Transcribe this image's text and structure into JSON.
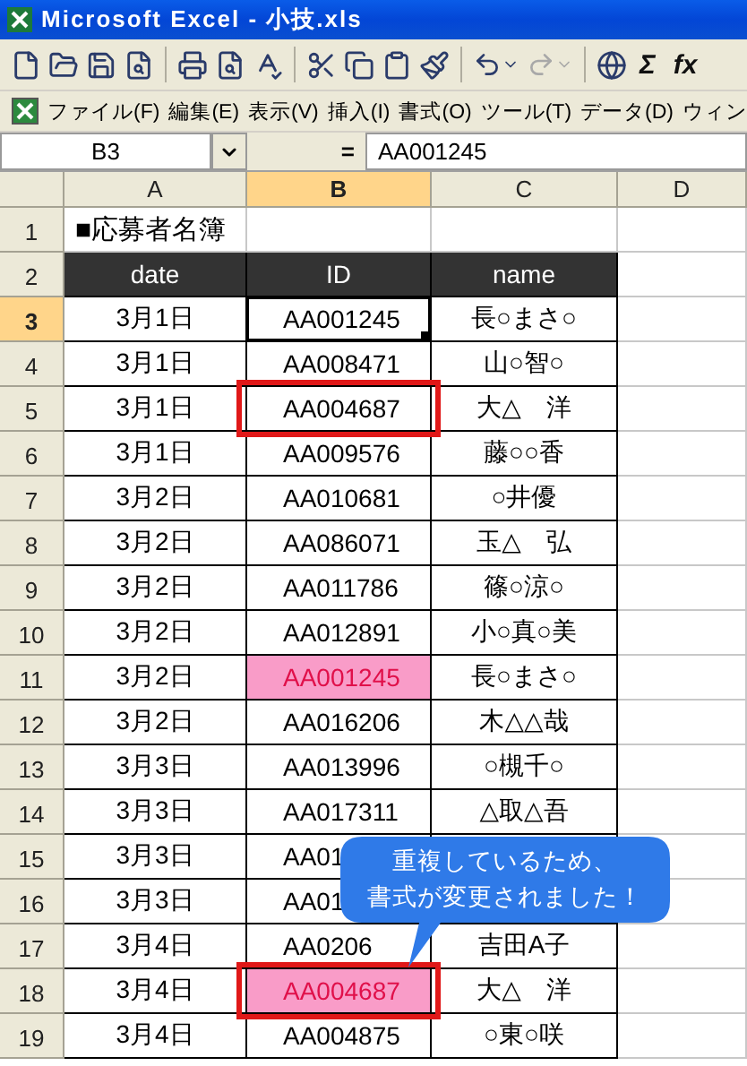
{
  "window": {
    "title": "Microsoft Excel - 小技.xls"
  },
  "toolbar": {
    "glyphs": [
      "Σ",
      "fx"
    ]
  },
  "menu": [
    "ファイル(F)",
    "編集(E)",
    "表示(V)",
    "挿入(I)",
    "書式(O)",
    "ツール(T)",
    "データ(D)",
    "ウィン"
  ],
  "formula_bar": {
    "name_box": "B3",
    "equals": "=",
    "value": "AA001245"
  },
  "columns": [
    {
      "label": "A",
      "selected": false
    },
    {
      "label": "B",
      "selected": true
    },
    {
      "label": "C",
      "selected": false
    },
    {
      "label": "D",
      "selected": false
    }
  ],
  "rows": [
    {
      "number": "1",
      "selected": false,
      "kind": "title",
      "text": "■応募者名簿"
    },
    {
      "number": "2",
      "selected": false,
      "kind": "header",
      "cells": [
        "date",
        "ID",
        "name"
      ]
    },
    {
      "number": "3",
      "selected": true,
      "kind": "data",
      "date": "3月1日",
      "id": "AA001245",
      "name": "長○まさ○",
      "active": true,
      "duplicate": false,
      "framed": false
    },
    {
      "number": "4",
      "selected": false,
      "kind": "data",
      "date": "3月1日",
      "id": "AA008471",
      "name": "山○智○",
      "active": false,
      "duplicate": false,
      "framed": false
    },
    {
      "number": "5",
      "selected": false,
      "kind": "data",
      "date": "3月1日",
      "id": "AA004687",
      "name": "大△　洋",
      "active": false,
      "duplicate": false,
      "framed": true
    },
    {
      "number": "6",
      "selected": false,
      "kind": "data",
      "date": "3月1日",
      "id": "AA009576",
      "name": "藤○○香",
      "active": false,
      "duplicate": false,
      "framed": false
    },
    {
      "number": "7",
      "selected": false,
      "kind": "data",
      "date": "3月2日",
      "id": "AA010681",
      "name": "○井優",
      "active": false,
      "duplicate": false,
      "framed": false
    },
    {
      "number": "8",
      "selected": false,
      "kind": "data",
      "date": "3月2日",
      "id": "AA086071",
      "name": "玉△　弘",
      "active": false,
      "duplicate": false,
      "framed": false
    },
    {
      "number": "9",
      "selected": false,
      "kind": "data",
      "date": "3月2日",
      "id": "AA011786",
      "name": "篠○涼○",
      "active": false,
      "duplicate": false,
      "framed": false
    },
    {
      "number": "10",
      "selected": false,
      "kind": "data",
      "date": "3月2日",
      "id": "AA012891",
      "name": "小○真○美",
      "active": false,
      "duplicate": false,
      "framed": false
    },
    {
      "number": "11",
      "selected": false,
      "kind": "data",
      "date": "3月2日",
      "id": "AA001245",
      "name": "長○まさ○",
      "active": false,
      "duplicate": true,
      "framed": false
    },
    {
      "number": "12",
      "selected": false,
      "kind": "data",
      "date": "3月2日",
      "id": "AA016206",
      "name": "木△△哉",
      "active": false,
      "duplicate": false,
      "framed": false
    },
    {
      "number": "13",
      "selected": false,
      "kind": "data",
      "date": "3月3日",
      "id": "AA013996",
      "name": "○槻千○",
      "active": false,
      "duplicate": false,
      "framed": false
    },
    {
      "number": "14",
      "selected": false,
      "kind": "data",
      "date": "3月3日",
      "id": "AA017311",
      "name": "△取△吾",
      "active": false,
      "duplicate": false,
      "framed": false
    },
    {
      "number": "15",
      "selected": false,
      "kind": "data",
      "date": "3月3日",
      "id": "AA01",
      "active": false,
      "duplicate": false,
      "framed": false
    },
    {
      "number": "16",
      "selected": false,
      "kind": "data",
      "date": "3月3日",
      "id": "AA01",
      "active": false,
      "duplicate": false,
      "framed": false
    },
    {
      "number": "17",
      "selected": false,
      "kind": "data",
      "date": "3月4日",
      "id": "AA0206",
      "name": "吉田A子",
      "active": false,
      "duplicate": false,
      "framed": false
    },
    {
      "number": "18",
      "selected": false,
      "kind": "data",
      "date": "3月4日",
      "id": "AA004687",
      "name": "大△　洋",
      "active": false,
      "duplicate": true,
      "framed": true
    },
    {
      "number": "19",
      "selected": false,
      "kind": "data",
      "date": "3月4日",
      "id": "AA004875",
      "name": "○東○咲",
      "active": false,
      "duplicate": false,
      "framed": false
    }
  ],
  "callout": {
    "lines": [
      "重複しているため、",
      "書式が変更されました！"
    ]
  }
}
